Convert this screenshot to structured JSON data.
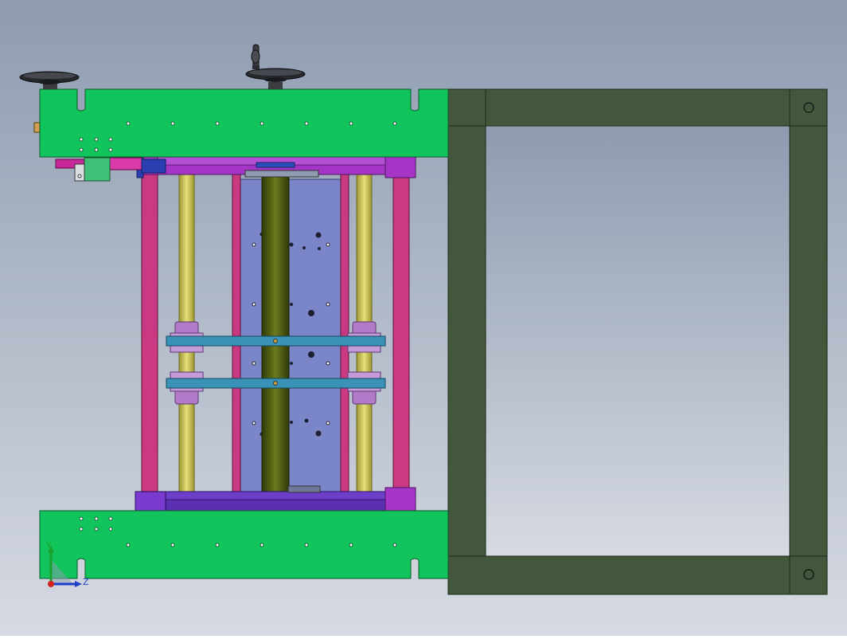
{
  "view": {
    "type": "CAD assembly drawing (side view)",
    "background": {
      "top": "#8e9bb0",
      "bottom": "#d6dae2"
    }
  },
  "colors": {
    "plate": "#11c45c",
    "frame": "#43573c",
    "post": "#c93a82",
    "beam": "#a435c6",
    "rod": "#cfc85a",
    "panel": "#7b86c8",
    "shaft": "#4d5c12",
    "crossbar": "#3a93b6",
    "collar": "#b27ac8",
    "base_beam": "#5a2fb0",
    "handwheel": "#26282c",
    "cylinder": "#c8289a",
    "bracket": "#3ec077"
  },
  "icons": [
    "handwheel-icon",
    "axis-triad-icon"
  ],
  "triad": {
    "y_label": "Y",
    "z_label": "Z"
  }
}
